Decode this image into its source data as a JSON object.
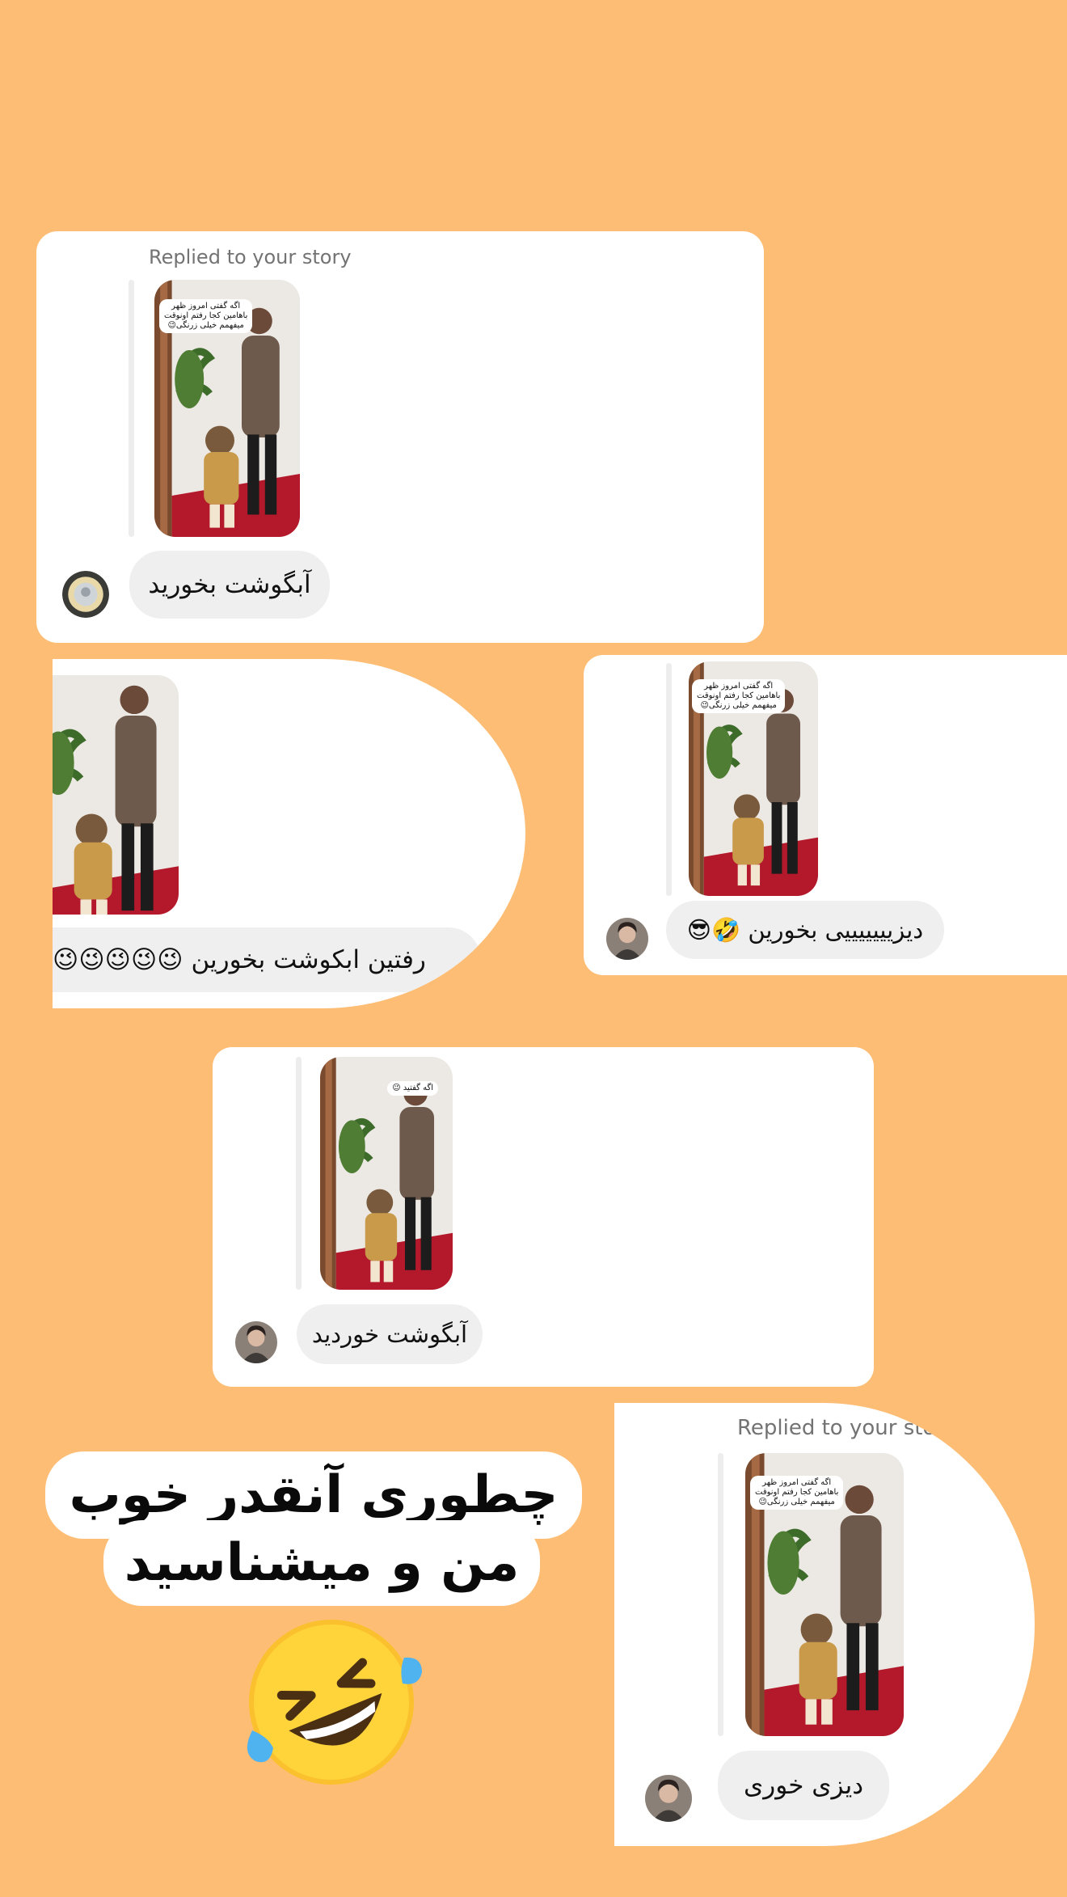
{
  "background_color": "#fdbd74",
  "cards": [
    {
      "replied_label": "Replied to your story",
      "story_tag": "اگه گفتی امروز ظهر\nباهامین کجا رفتم اونوقت\nمیفهمم خیلی زرنگی😉",
      "reply": "آبگوشت بخورید"
    },
    {
      "reply": "رفتین ابکوشت بخورین 😉😉😉😉😉"
    },
    {
      "story_tag": "اگه گفتی امروز ظهر\nباهامین کجا رفتم اونوقت\nمیفهمم خیلی زرنگی😉",
      "reply": "دیزیییییییی بخورین 🤣😎"
    },
    {
      "story_tag": "اگه گفتید 😉",
      "reply": "آبگوشت خوردید"
    },
    {
      "replied_label": "Replied to your story",
      "story_tag": "اگه گفتی امروز ظهر\nباهامین کجا رفتم اونوقت\nمیفهمم خیلی زرنگی😉",
      "reply": "دیزی خوری"
    }
  ],
  "caption": {
    "line1": "چطوری آنقدر خوب",
    "line2": "من و میشناسید",
    "emoji": "rolling-on-floor-laughing-emoji"
  }
}
